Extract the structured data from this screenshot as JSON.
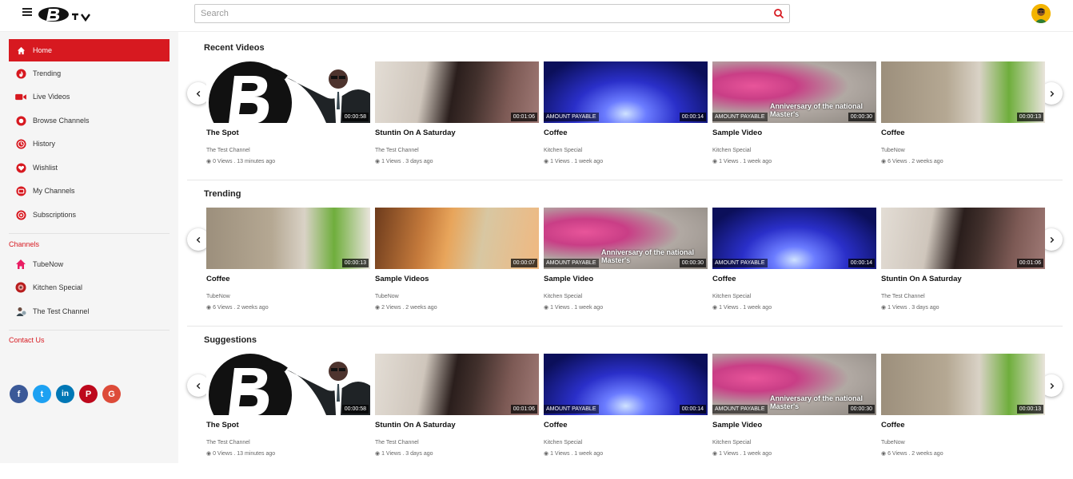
{
  "header": {
    "search_placeholder": "Search"
  },
  "sidebar": {
    "items": [
      {
        "label": "Home"
      },
      {
        "label": "Trending"
      },
      {
        "label": "Live Videos"
      },
      {
        "label": "Browse Channels"
      },
      {
        "label": "History"
      },
      {
        "label": "Wishlist"
      },
      {
        "label": "My Channels"
      },
      {
        "label": "Subscriptions"
      }
    ],
    "channels_title": "Channels",
    "channels": [
      {
        "label": "TubeNow"
      },
      {
        "label": "Kitchen Special"
      },
      {
        "label": "The Test Channel"
      }
    ],
    "contact_title": "Contact Us",
    "social": [
      {
        "icon": "facebook-icon",
        "glyph": "f",
        "color": "#3b5998"
      },
      {
        "icon": "twitter-icon",
        "glyph": "t",
        "color": "#1da1f2"
      },
      {
        "icon": "linkedin-icon",
        "glyph": "in",
        "color": "#0077b5"
      },
      {
        "icon": "pinterest-icon",
        "glyph": "P",
        "color": "#bd081c"
      },
      {
        "icon": "google-icon",
        "glyph": "G",
        "color": "#dd4b39"
      }
    ]
  },
  "sections": [
    {
      "title": "Recent Videos",
      "videos": [
        {
          "title": "The Spot",
          "channel": "The Test Channel",
          "meta": "0 Views . 13 minutes ago",
          "duration": "00:00:58",
          "art": "spot"
        },
        {
          "title": "Stuntin On A Saturday",
          "channel": "The Test Channel",
          "meta": "1 Views . 3 days ago",
          "duration": "00:01:06",
          "art": "stuntin"
        },
        {
          "title": "Coffee",
          "channel": "Kitchen Special",
          "meta": "1 Views . 1 week ago",
          "duration": "00:00:14",
          "art": "coffee",
          "badge": "AMOUNT PAYABLE"
        },
        {
          "title": "Sample Video",
          "channel": "Kitchen Special",
          "meta": "1 Views . 1 week ago",
          "duration": "00:00:30",
          "art": "sample",
          "badge": "AMOUNT PAYABLE",
          "overlay": "Anniversary of the national Master's"
        },
        {
          "title": "Coffee",
          "channel": "TubeNow",
          "meta": "6 Views . 2 weeks ago",
          "duration": "00:00:13",
          "art": "kitchen"
        }
      ]
    },
    {
      "title": "Trending",
      "videos": [
        {
          "title": "Coffee",
          "channel": "TubeNow",
          "meta": "6 Views . 2 weeks ago",
          "duration": "00:00:13",
          "art": "kitchen"
        },
        {
          "title": "Sample Videos",
          "channel": "TubeNow",
          "meta": "2 Views . 2 weeks ago",
          "duration": "00:00:07",
          "art": "guitar"
        },
        {
          "title": "Sample Video",
          "channel": "Kitchen Special",
          "meta": "1 Views . 1 week ago",
          "duration": "00:00:30",
          "art": "sample",
          "badge": "AMOUNT PAYABLE",
          "overlay": "Anniversary of the national Master's"
        },
        {
          "title": "Coffee",
          "channel": "Kitchen Special",
          "meta": "1 Views . 1 week ago",
          "duration": "00:00:14",
          "art": "coffee",
          "badge": "AMOUNT PAYABLE"
        },
        {
          "title": "Stuntin On A Saturday",
          "channel": "The Test Channel",
          "meta": "1 Views . 3 days ago",
          "duration": "00:01:06",
          "art": "stuntin"
        }
      ]
    },
    {
      "title": "Suggestions",
      "videos": [
        {
          "title": "The Spot",
          "channel": "The Test Channel",
          "meta": "0 Views . 13 minutes ago",
          "duration": "00:00:58",
          "art": "spot"
        },
        {
          "title": "Stuntin On A Saturday",
          "channel": "The Test Channel",
          "meta": "1 Views . 3 days ago",
          "duration": "00:01:06",
          "art": "stuntin"
        },
        {
          "title": "Coffee",
          "channel": "Kitchen Special",
          "meta": "1 Views . 1 week ago",
          "duration": "00:00:14",
          "art": "coffee",
          "badge": "AMOUNT PAYABLE"
        },
        {
          "title": "Sample Video",
          "channel": "Kitchen Special",
          "meta": "1 Views . 1 week ago",
          "duration": "00:00:30",
          "art": "sample",
          "badge": "AMOUNT PAYABLE",
          "overlay": "Anniversary of the national Master's"
        },
        {
          "title": "Coffee",
          "channel": "TubeNow",
          "meta": "6 Views . 2 weeks ago",
          "duration": "00:00:13",
          "art": "kitchen"
        }
      ]
    }
  ],
  "colors": {
    "accent": "#d71920",
    "sidebar_bg": "#f5f5f5"
  }
}
